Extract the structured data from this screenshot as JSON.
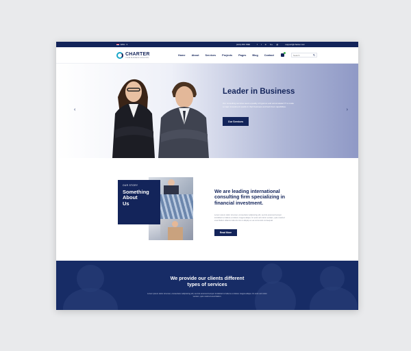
{
  "topbar": {
    "language": "ENG",
    "phone": "(123) 456 7890",
    "email": "support@charter.com",
    "socials": [
      "f",
      "t",
      "in",
      "G+",
      "@"
    ]
  },
  "nav": {
    "logo_name": "CHARTER",
    "logo_tagline": "YOUR BUSINESS SOLUTION",
    "menu": [
      "Home",
      "About",
      "Services",
      "Projects",
      "Pages",
      "Blog",
      "Contact"
    ],
    "cart_icon": "cart-icon",
    "search_placeholder": "Search"
  },
  "hero": {
    "title": "Leader in Business",
    "subtitle": "Our consulting services seek a quality of rigorous and accumulated IT to make a major investment results in their business and look their capabilities.",
    "button": "Our Services",
    "prev_icon": "chevron-left-icon",
    "next_icon": "chevron-right-icon"
  },
  "story": {
    "eyebrow": "OUR STORY",
    "title": "Something\nAbout\nUs",
    "heading": "We are leading international\nconsulting firm specializing in\nfinancial investment.",
    "paragraph": "Lorem ipsum dolor sit amet, consectetur adipiscing elit, sed do eiusmod tempor incididunt ut labore et dolore magna aliqua. Ut enim ad minim veniam, quis nostrud exercitation ullamco laboris nisi ut aliquip ex ea commodo consequat.",
    "button": "Read More"
  },
  "services": {
    "title": "We provide our clients different\ntypes of services",
    "description": "Lorem ipsum dolor sit amet, consectetur adipiscing elit, sed do eiusmod tempor incididunt ut labore et dolore magna aliqua. Ut enim ad minim veniam, quis nostrud exercitation."
  },
  "colors": {
    "navy": "#13245a",
    "accent": "#19a7c9",
    "green": "#3fb34f"
  }
}
